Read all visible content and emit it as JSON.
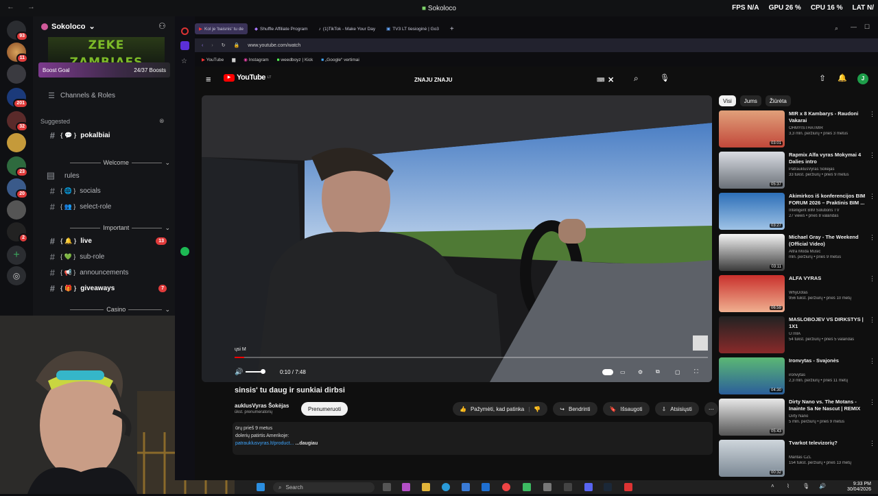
{
  "titlebar": {
    "title": "Sokoloco",
    "nav": "← →"
  },
  "stats": {
    "fps_label": "FPS",
    "fps_value": "N/A",
    "gpu_label": "GPU",
    "gpu_value": "26 %",
    "cpu_label": "CPU",
    "cpu_value": "16 %",
    "lat_label": "LAT",
    "lat_value": "N/"
  },
  "discord": {
    "server_badges": [
      "93",
      "11",
      "201",
      "32",
      "23",
      "20",
      "2"
    ],
    "server_name": "Sokoloco",
    "boost": {
      "label": "Boost Goal",
      "count": "24/37 Boosts"
    },
    "channels_roles": "Channels & Roles",
    "suggested": "Suggested",
    "rows": {
      "pokalbiai": "pokalbiai",
      "welcome": "Welcome",
      "rules": "rules",
      "socials": "socials",
      "select_role": "select-role",
      "important": "Important",
      "live": "live",
      "live_count": "13",
      "sub_role": "sub-role",
      "announcements": "announcements",
      "giveaways": "giveaways",
      "giveaways_count": "7",
      "casino": "Casino"
    }
  },
  "browser": {
    "tabs": [
      "Kol je 'baisnis' tu de",
      "Shuffle Affiliate Program",
      "(1)TikTok - Make Your Day",
      "TV3 LT tiesioginė | Go3"
    ],
    "url": "www.youtube.com/watch",
    "bookmarks": [
      "YouTube",
      "Instagram",
      "weedboyz | Kick",
      "„Google“ vertimai"
    ]
  },
  "youtube": {
    "logo": "YouTube",
    "logo_sup": "LT",
    "search_value": "ZNAJU ZNAJU",
    "avatar_letter": "J",
    "overlay_text": "ųsi M",
    "time": "0:10 / 7:48",
    "progress": 0.021,
    "video_title": "sinsis' tu daug ir sunkiai dirbsi",
    "channel": "auklusVyras Šokėjas",
    "subs": "ūkst. prenumeratorių",
    "subscribe": "Prenumeruoti",
    "like": "Pažymėti, kad patinka",
    "share": "Bendrinti",
    "save": "Išsaugoti",
    "download": "Atsisiųsti",
    "desc_line1": "ūrų  prieš 9 metus",
    "desc_line2": "dolerių patirtis Amerikoje:",
    "desc_link": "patrauklusvyras.lt/product...",
    "desc_more": "...daugiau",
    "chips": [
      "Visi",
      "Jums",
      "Žiūrėta"
    ],
    "recs": [
      {
        "title": "MIR x 8 Kambarys - Raudoni Vakarai",
        "channel": "OHMYISTHATMIR",
        "meta": "3,3 mln. peržiūrų • prieš 3 metus",
        "dur": "03:01"
      },
      {
        "title": "Rapmix Alfa vyras Mokymai 4 Dalies intro",
        "channel": "PatrauklusVyras Šokėjas",
        "meta": "33 tūkst. peržiūrų • prieš 9 metus",
        "dur": "05:37"
      },
      {
        "title": "Akimirkos iš konferencijos BIM FORUM 2026 – Praktinis BIM ...",
        "channel": "Intelligent BIM Solutions TV",
        "meta": "27 views • prieš 8 valandas",
        "dur": "03:27"
      },
      {
        "title": "Michael Gray - The Weekend (Official Video)",
        "channel": "Altra Moda Music",
        "meta": "mln. peržiūrų • prieš 9 metus",
        "dur": "03:11"
      },
      {
        "title": "ALFA VYRAS",
        "channel": "WhyDotas",
        "meta": "956 tūkst. peržiūrų • prieš 10 metų",
        "dur": "06:59"
      },
      {
        "title": "MASLOBOJEV VS DIRKSTYS | 1X1",
        "channel": "UTMA",
        "meta": "54 tūkst. peržiūrų • prieš 5 valandas",
        "dur": ""
      },
      {
        "title": "Ironvytas - Svajonės",
        "channel": "ironvytas",
        "meta": "2,3 mln. peržiūrų • prieš 11 metų",
        "dur": "04:30"
      },
      {
        "title": "Dirty Nano vs. The Motans - Inainte Sa Ne Nascut | REMIX",
        "channel": "Dirty Nano",
        "meta": "5 mln. peržiūrų • prieš 9 metus",
        "dur": "05:43"
      },
      {
        "title": "Tvarkot televizorių?",
        "channel": "Mantas CZL",
        "meta": "154 tūkst. peržiūrų • prieš 13 metų",
        "dur": "00:32"
      }
    ]
  },
  "taskbar": {
    "search": "Search",
    "time": "9:33 PM",
    "date": "30/04/2026"
  },
  "colors": {
    "accent": "#5865f2",
    "badge": "#e03b3b",
    "youtube_red": "#ff0000"
  }
}
